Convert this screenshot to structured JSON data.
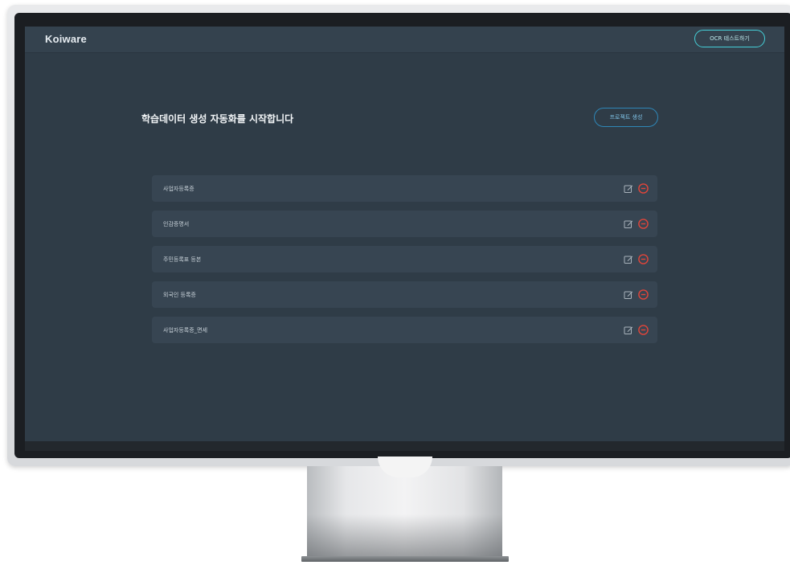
{
  "app": {
    "logo": "Koiware",
    "header_button": "OCR 테스트하기"
  },
  "main": {
    "title": "학습데이터 생성 자동화를 시작합니다",
    "create_button": "프로젝트 생성"
  },
  "items": [
    {
      "label": "사업자등록증"
    },
    {
      "label": "인감증명서"
    },
    {
      "label": "주민등록표 등본"
    },
    {
      "label": "외국인 등록증"
    },
    {
      "label": "사업자등록증_면세"
    }
  ],
  "colors": {
    "screen_bg": "#2f3c47",
    "header_bg": "#34424e",
    "item_bg": "#374552",
    "accent_cyan": "#45d0d8",
    "accent_blue": "#2f87b8",
    "delete_red": "#e2453a"
  },
  "icons": {
    "edit": "edit-icon",
    "delete": "minus-circle-icon"
  }
}
